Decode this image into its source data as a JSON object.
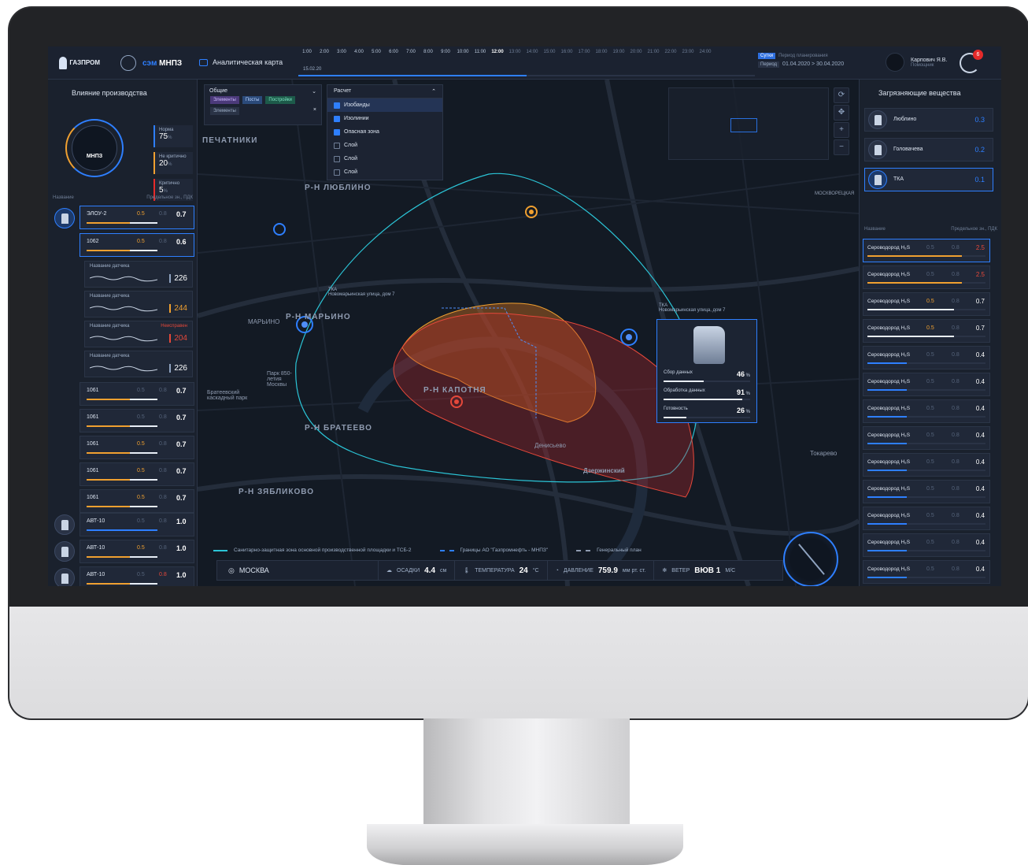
{
  "app": {
    "logo_text": "ГАЗПРОМ",
    "brand_prefix": "сэм",
    "brand_name": "МНПЗ",
    "map_title": "Аналитическая карта"
  },
  "timeline": {
    "hours": [
      "1:00",
      "2:00",
      "3:00",
      "4:00",
      "5:00",
      "6:00",
      "7:00",
      "8:00",
      "9:00",
      "10:00",
      "11:00",
      "12:00",
      "13:00",
      "14:00",
      "15:00",
      "16:00",
      "17:00",
      "18:00",
      "19:00",
      "20:00",
      "21:00",
      "22:00",
      "23:00",
      "24:00"
    ],
    "current_hour": "12:00",
    "date": "15.02.20"
  },
  "period": {
    "mode_day": "Сутки",
    "mode_period": "Период",
    "caption": "Период планирования",
    "range": "01.04.2020 > 30.04.2020"
  },
  "user": {
    "name": "Карпович Я.В.",
    "role": "Помощник",
    "notifications": "6"
  },
  "left": {
    "title": "Влияние производства",
    "gauge_label": "МНПЗ",
    "stats": [
      {
        "title": "Норма",
        "value": "75",
        "unit": "%",
        "color": "#2e7fff"
      },
      {
        "title": "Не критично",
        "value": "20",
        "unit": "%",
        "color": "#f0a030"
      },
      {
        "title": "Критично",
        "value": "5",
        "unit": "%",
        "color": "#e52a2a"
      }
    ],
    "col_name": "Название",
    "col_limit": "Предельное зн., ПДК",
    "main_row": {
      "name": "ЭЛОУ-2",
      "a": "0.5",
      "b": "0.8",
      "c": "0.7"
    },
    "sub_row": {
      "name": "1062",
      "a": "0.5",
      "b": "0.8",
      "c": "0.6"
    },
    "sensors": [
      {
        "title": "Название датчика",
        "status": "",
        "value": "226"
      },
      {
        "title": "Название датчика",
        "status": "",
        "value": "244"
      },
      {
        "title": "Название датчика",
        "status": "Неисправен",
        "value": "204"
      },
      {
        "title": "Название датчика",
        "status": "",
        "value": "226"
      }
    ],
    "units": [
      {
        "name": "1061",
        "a": "0.5",
        "b": "0.8",
        "c": "0.7"
      },
      {
        "name": "1061",
        "a": "0.5",
        "b": "0.8",
        "c": "0.7"
      },
      {
        "name": "1061",
        "a": "0.5",
        "b": "0.8",
        "c": "0.7"
      },
      {
        "name": "1061",
        "a": "0.5",
        "b": "0.8",
        "c": "0.7"
      },
      {
        "name": "1061",
        "a": "0.5",
        "b": "0.8",
        "c": "0.7"
      }
    ],
    "plants": [
      {
        "name": "АВТ-10",
        "a": "0.5",
        "b": "0.8",
        "c": "1.0"
      },
      {
        "name": "АВТ-10",
        "a": "0.5",
        "b": "0.8",
        "c": "1.0"
      },
      {
        "name": "АВТ-10",
        "a": "0.5",
        "b": "0.8",
        "c": "1.0"
      }
    ]
  },
  "filters": {
    "general": "Общие",
    "chips": [
      "Элементы",
      "Посты",
      "Постройки",
      "Элементы"
    ],
    "calc": "Расчет",
    "options": [
      {
        "label": "Изобанды",
        "checked": true
      },
      {
        "label": "Изолинии",
        "checked": true
      },
      {
        "label": "Опасная зона",
        "checked": true
      },
      {
        "label": "Слой",
        "checked": false
      },
      {
        "label": "Слой",
        "checked": false
      },
      {
        "label": "Слой",
        "checked": false
      }
    ]
  },
  "map": {
    "labels": [
      "ПЕЧАТНИКИ",
      "Р-Н ЛЮБЛИНО",
      "Р-Н МАРЬИНО",
      "МАРЬИНО",
      "Р-Н КАПОТНЯ",
      "Р-Н БРАТЕЕВО",
      "Р-Н ЗЯБЛИКОВО",
      "Дзержинский",
      "Денисьево",
      "Токарево",
      "Парк 850-летия Москвы",
      "Братеевский каскадный парк",
      "МОСКВОРЕЦКАЯ"
    ],
    "tka_left": {
      "name": "ТКА",
      "address": "Новомарьинская улица, дом 7"
    },
    "tka_right": {
      "name": "ТКА",
      "address": "Новомарьинская улица, дом 7"
    },
    "info": [
      {
        "label": "Сбор данных",
        "value": "46",
        "unit": "%",
        "progress": 0.46
      },
      {
        "label": "Обработка данных",
        "value": "91",
        "unit": "%",
        "progress": 0.91
      },
      {
        "label": "Готовность",
        "value": "26",
        "unit": "%",
        "progress": 0.26
      }
    ],
    "legend": [
      "Санитарно-защитная зона основной производственной площадки и ТСБ-2",
      "Границы АО \"Газпромнефть - МНПЗ\"",
      "Генеральный план"
    ],
    "weather": {
      "city": "МОСКВА",
      "rain_label": "ОСАДКИ",
      "rain_value": "4.4",
      "rain_unit": "см",
      "temp_label": "ТЕМПЕРАТУРА",
      "temp_value": "24",
      "temp_unit": "°C",
      "press_label": "ДАВЛЕНИЕ",
      "press_value": "759.9",
      "press_unit": "мм рт. ст.",
      "wind_label": "ВЕТЕР",
      "wind_value": "ВЮВ 1",
      "wind_unit": "М/С"
    }
  },
  "right": {
    "title": "Загрязняющие вещества",
    "locations": [
      {
        "name": "Люблино",
        "value": "0.3"
      },
      {
        "name": "Головачева",
        "value": "0.2"
      },
      {
        "name": "ТКА",
        "value": "0.1"
      }
    ],
    "col_name": "Название",
    "col_limit": "Предельное зн., ПДК",
    "substances": [
      {
        "name": "Сероводород H₂S",
        "a": "0.5",
        "b": "0.8",
        "c": "2.5"
      },
      {
        "name": "Сероводород H₂S",
        "a": "0.5",
        "b": "0.8",
        "c": "2.5"
      },
      {
        "name": "Сероводород H₂S",
        "a": "0.5",
        "b": "0.8",
        "c": "0.7"
      },
      {
        "name": "Сероводород H₂S",
        "a": "0.5",
        "b": "0.8",
        "c": "0.7"
      },
      {
        "name": "Сероводород H₂S",
        "a": "0.5",
        "b": "0.8",
        "c": "0.4"
      },
      {
        "name": "Сероводород H₂S",
        "a": "0.5",
        "b": "0.8",
        "c": "0.4"
      },
      {
        "name": "Сероводород H₂S",
        "a": "0.5",
        "b": "0.8",
        "c": "0.4"
      },
      {
        "name": "Сероводород H₂S",
        "a": "0.5",
        "b": "0.8",
        "c": "0.4"
      },
      {
        "name": "Сероводород H₂S",
        "a": "0.5",
        "b": "0.8",
        "c": "0.4"
      },
      {
        "name": "Сероводород H₂S",
        "a": "0.5",
        "b": "0.8",
        "c": "0.4"
      },
      {
        "name": "Сероводород H₂S",
        "a": "0.5",
        "b": "0.8",
        "c": "0.4"
      },
      {
        "name": "Сероводород H₂S",
        "a": "0.5",
        "b": "0.8",
        "c": "0.4"
      },
      {
        "name": "Сероводород H₂S",
        "a": "0.5",
        "b": "0.8",
        "c": "0.4"
      },
      {
        "name": "Сероводород H₂S",
        "a": "0.5",
        "b": "0.8",
        "c": "0.4"
      }
    ]
  }
}
